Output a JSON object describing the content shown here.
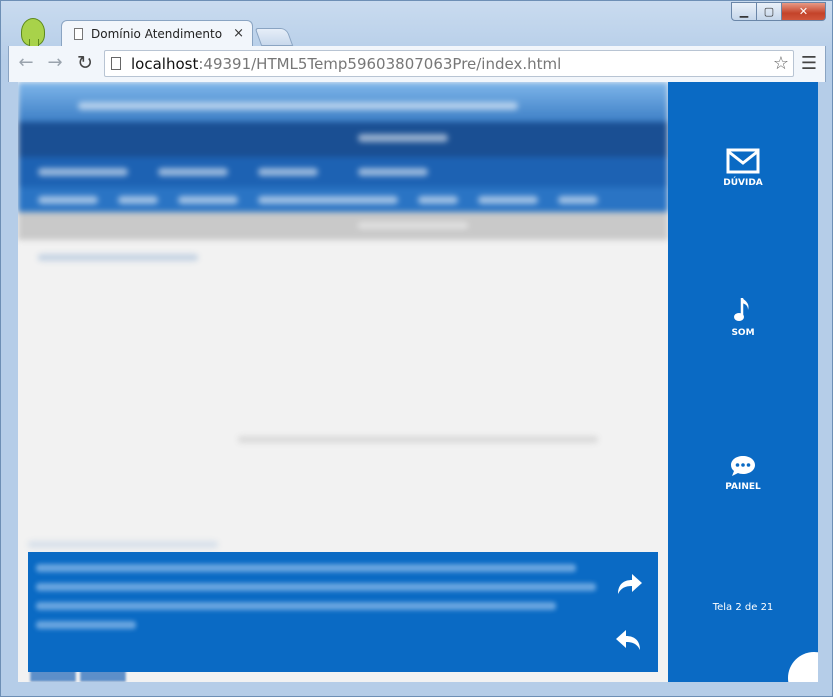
{
  "browser": {
    "tab_title": "Domínio Atendimento",
    "tab_close": "×",
    "url_host": "localhost",
    "url_rest": ":49391/HTML5Temp59603807063Pre/index.html",
    "controls": {
      "minimize": "▁",
      "maximize": "▢",
      "close": "✕"
    }
  },
  "sidebar": {
    "items": [
      {
        "label": "DÚVIDA",
        "icon": "mail-icon"
      },
      {
        "label": "SOM",
        "icon": "music-note-icon"
      },
      {
        "label": "PAINEL",
        "icon": "chat-bubble-icon"
      }
    ],
    "page_indicator": "Tela 2 de 21"
  },
  "colors": {
    "sidebar_blue": "#0a6ac4",
    "content_bg": "#f2f2f2"
  }
}
